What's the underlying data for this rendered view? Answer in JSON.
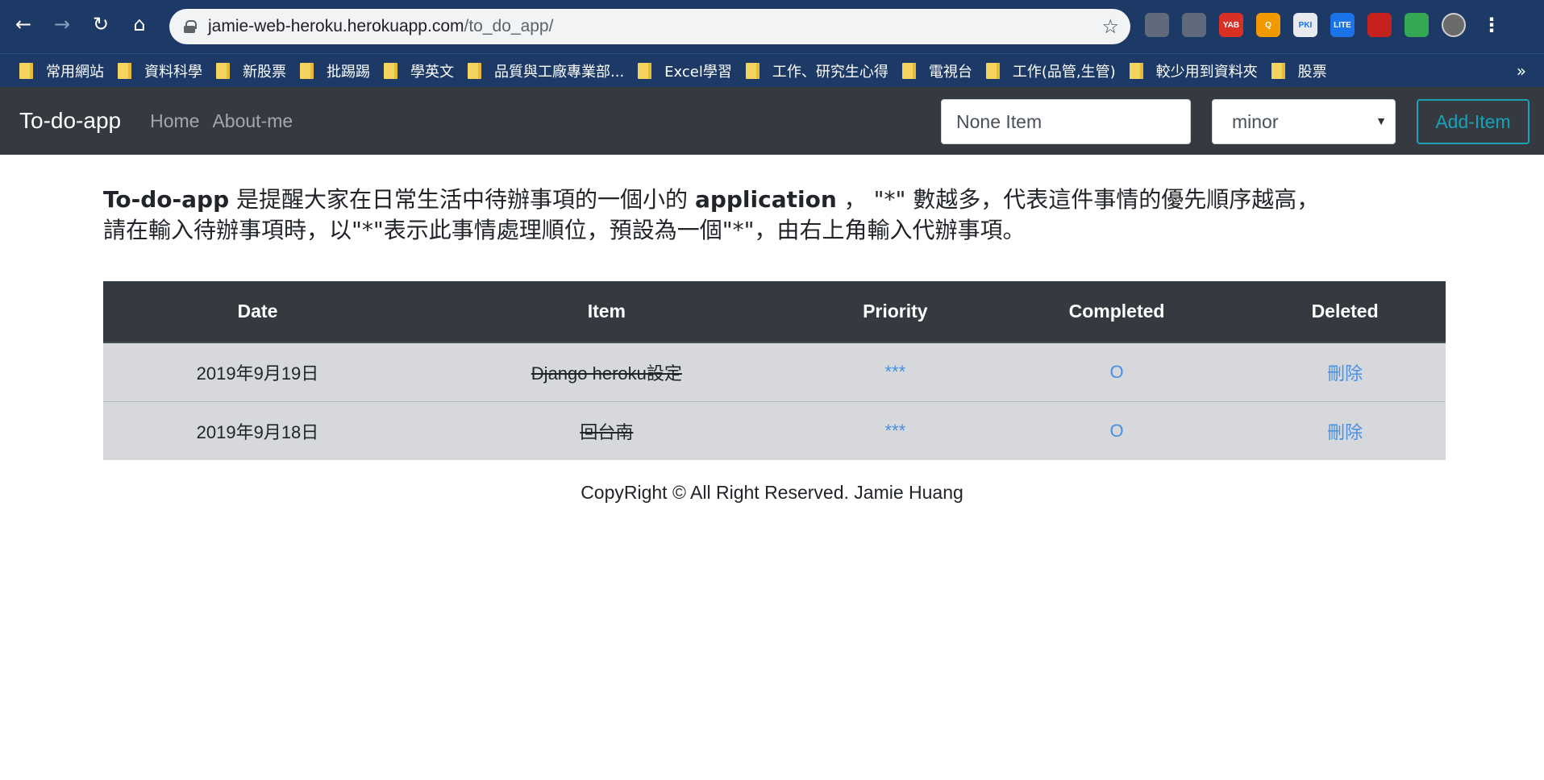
{
  "browser": {
    "url_host": "jamie-web-heroku.herokuapp.com",
    "url_path": "/to_do_app/",
    "bookmarks": [
      "常用網站",
      "資料科學",
      "新股票",
      "批踢踢",
      "學英文",
      "品質與工廠專業部...",
      "Excel學習",
      "工作、研究生心得",
      "電視台",
      "工作(品管,生管)",
      "較少用到資料夾",
      "股票"
    ],
    "extensions": [
      {
        "name": "camera-extension-icon",
        "label": "",
        "color": "#5f6b7a"
      },
      {
        "name": "ticket-extension-icon",
        "label": "",
        "color": "#5f6b7a"
      },
      {
        "name": "yab-extension-icon",
        "label": "YAB",
        "color": "#d93025"
      },
      {
        "name": "q-extension-icon",
        "label": "Q",
        "color": "#f29900"
      },
      {
        "name": "smartpki-extension-icon",
        "label": "PKI",
        "color": "#e8eaed"
      },
      {
        "name": "lite-extension-icon",
        "label": "LITE",
        "color": "#1a73e8"
      },
      {
        "name": "red-extension-icon",
        "label": "",
        "color": "#c5221f"
      },
      {
        "name": "green-extension-icon",
        "label": "",
        "color": "#34a853"
      }
    ]
  },
  "navbar": {
    "brand": "To-do-app",
    "links": [
      "Home",
      "About-me"
    ],
    "item_input_value": "None Item",
    "priority_select_value": "minor",
    "add_button": "Add-Item"
  },
  "intro": {
    "bold1": "To-do-app",
    "text1": " 是提醒大家在日常生活中待辦事項的一個小的 ",
    "bold2": "application",
    "text2": " ， \"*\" 數越多，代表這件事情的優先順序越高，",
    "line2": "請在輸入待辦事項時，以\"*\"表示此事情處理順位，預設為一個\"*\"，由右上角輸入代辦事項。"
  },
  "table": {
    "headers": [
      "Date",
      "Item",
      "Priority",
      "Completed",
      "Deleted"
    ],
    "rows": [
      {
        "date": "2019年9月19日",
        "item": "Django heroku設定",
        "priority": "***",
        "completed": "O",
        "deleted": "刪除"
      },
      {
        "date": "2019年9月18日",
        "item": "回台南",
        "priority": "***",
        "completed": "O",
        "deleted": "刪除"
      }
    ]
  },
  "footer": "CopyRight © All Right Reserved. Jamie Huang"
}
